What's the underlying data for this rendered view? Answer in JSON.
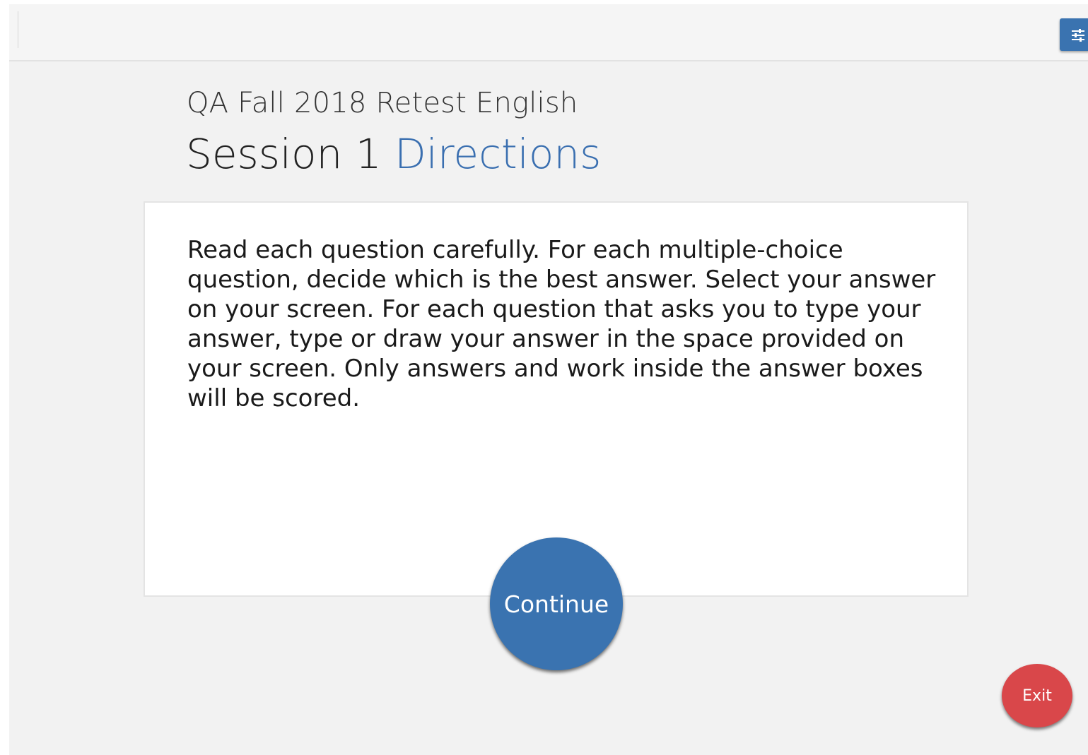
{
  "header": {
    "tools_icon": "sliders-icon"
  },
  "test": {
    "name": "QA Fall 2018 Retest English",
    "session_label": "Session 1",
    "section_label": "Directions"
  },
  "directions": {
    "text": "Read each question carefully. For each multiple-choice question, decide which is the best answer. Select your answer on your screen. For each question that asks you to type your answer, type or draw your answer in the space provided on your screen. Only answers and work inside the answer boxes will be scored."
  },
  "buttons": {
    "continue_label": "Continue",
    "exit_label": "Exit"
  },
  "colors": {
    "primary": "#3a73b0",
    "accent_text": "#3a6fb0",
    "exit": "#d9474a",
    "background": "#f2f2f2"
  }
}
